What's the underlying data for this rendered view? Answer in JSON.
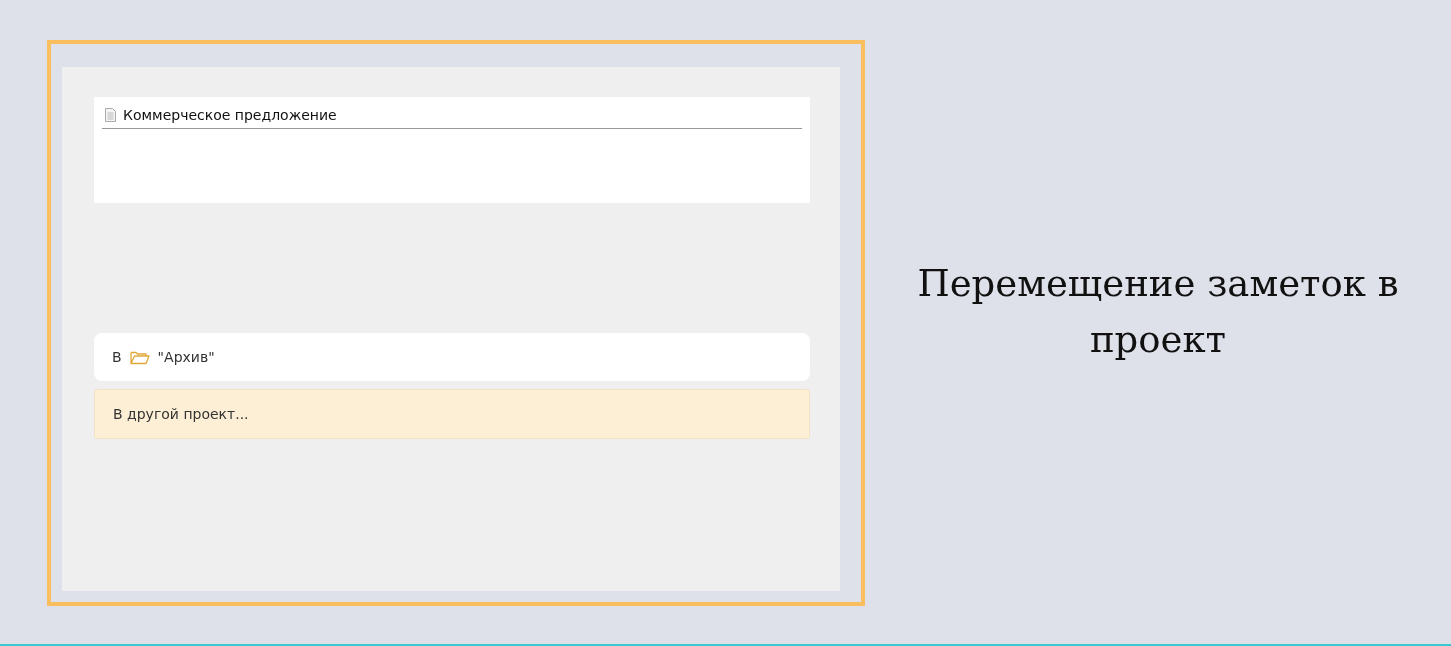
{
  "note": {
    "title": "Коммерческое предложение"
  },
  "menu": [
    {
      "kind": "project",
      "prefix": "В",
      "label": "\"Архив\"",
      "selected": false
    },
    {
      "kind": "other",
      "label": "В другой проект...",
      "selected": true
    }
  ],
  "caption": "Перемещение заметок в проект"
}
